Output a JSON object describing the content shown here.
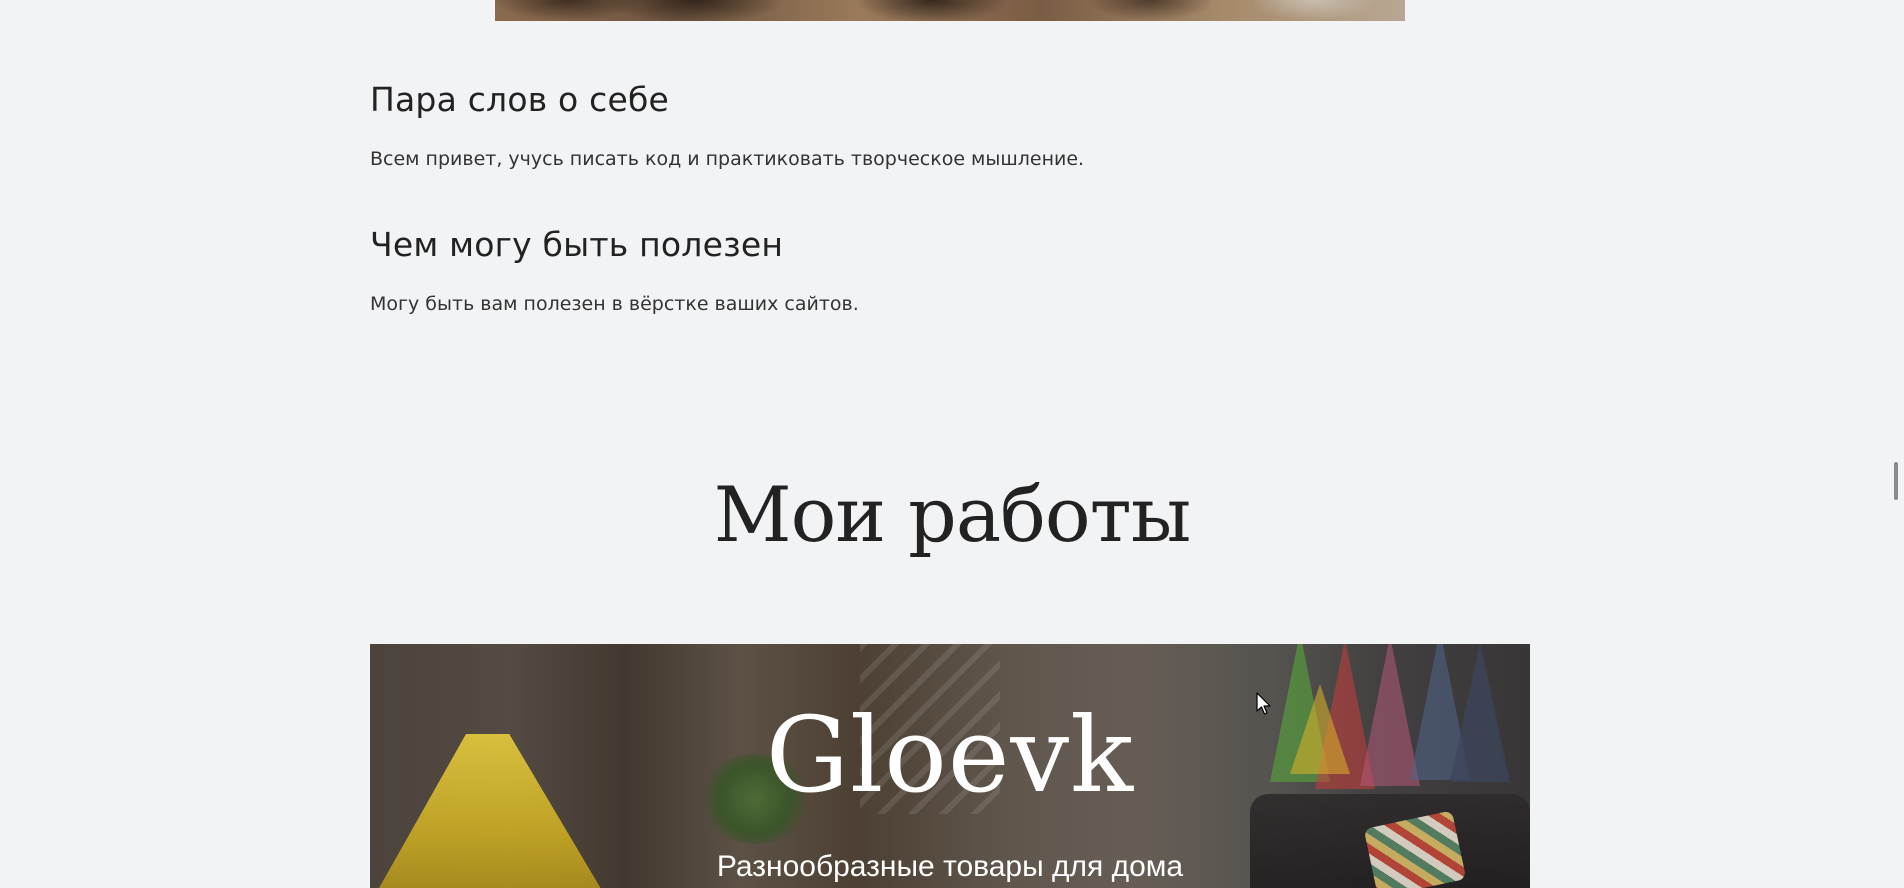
{
  "about": {
    "heading_1": "Пара слов о себе",
    "text_1": "Всем привет, учусь писать код и практиковать творческое мышление.",
    "heading_2": "Чем могу быть полезен",
    "text_2": "Могу быть вам полезен в вёрстке ваших сайтов."
  },
  "works": {
    "title": "Мои работы",
    "projects": [
      {
        "brand": "Gloevk",
        "tagline": "Разнообразные товары для дома"
      }
    ]
  },
  "icons": {
    "cursor": "mouse-pointer-icon"
  }
}
